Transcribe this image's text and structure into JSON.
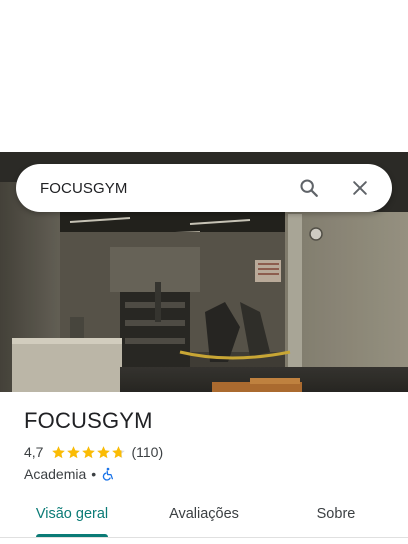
{
  "search": {
    "query": "FOCUSGYM",
    "search_icon": "search-icon",
    "close_icon": "close-icon"
  },
  "place": {
    "name": "FOCUSGYM",
    "rating": "4,7",
    "rating_value": 4.7,
    "review_count": "(110)",
    "category": "Academia",
    "separator": "•",
    "accessibility_icon": "wheelchair-icon"
  },
  "tabs": [
    {
      "label": "Visão geral",
      "active": true
    },
    {
      "label": "Avaliações",
      "active": false
    },
    {
      "label": "Sobre",
      "active": false
    }
  ],
  "colors": {
    "accent": "#0b7b76",
    "star": "#fbbc04",
    "accessibility": "#1a73e8"
  }
}
